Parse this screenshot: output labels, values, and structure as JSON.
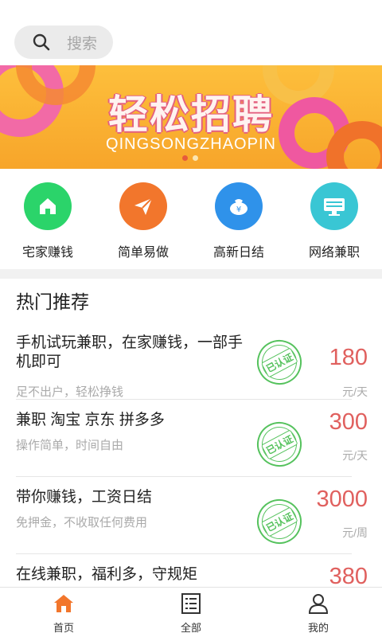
{
  "search": {
    "placeholder": "搜索",
    "icon": "search-icon"
  },
  "banner": {
    "title": "轻松招聘",
    "subtitle": "QINGSONGZHAOPIN",
    "active_dot_color": "#e75a3b"
  },
  "categories": [
    {
      "label": "宅家赚钱",
      "icon": "home-icon",
      "color": "#2bd46a"
    },
    {
      "label": "简单易做",
      "icon": "paper-plane-icon",
      "color": "#f2762c"
    },
    {
      "label": "高新日结",
      "icon": "money-bag-icon",
      "color": "#2f92ea"
    },
    {
      "label": "网络兼职",
      "icon": "monitor-icon",
      "color": "#39c6d4"
    }
  ],
  "hot": {
    "title": "热门推荐",
    "stamp_label": "已认证",
    "items": [
      {
        "title": "手机试玩兼职，在家赚钱，一部手机即可",
        "sub": "足不出户，轻松挣钱",
        "price": "180",
        "unit": "元/天"
      },
      {
        "title": "兼职 淘宝 京东 拼多多",
        "sub": "操作简单，时间自由",
        "price": "300",
        "unit": "元/天"
      },
      {
        "title": "带你赚钱，工资日结",
        "sub": "免押金，不收取任何费用",
        "price": "3000",
        "unit": "元/周"
      },
      {
        "title": "在线兼职，福利多，守规矩",
        "sub": "",
        "price": "380",
        "unit": ""
      }
    ]
  },
  "tabs": [
    {
      "label": "首页",
      "icon": "home-tab-icon",
      "active": true
    },
    {
      "label": "全部",
      "icon": "list-icon",
      "active": false
    },
    {
      "label": "我的",
      "icon": "user-icon",
      "active": false
    }
  ],
  "colors": {
    "accent": "#f2762c",
    "price": "#e0605e",
    "verified": "#55c25d"
  }
}
